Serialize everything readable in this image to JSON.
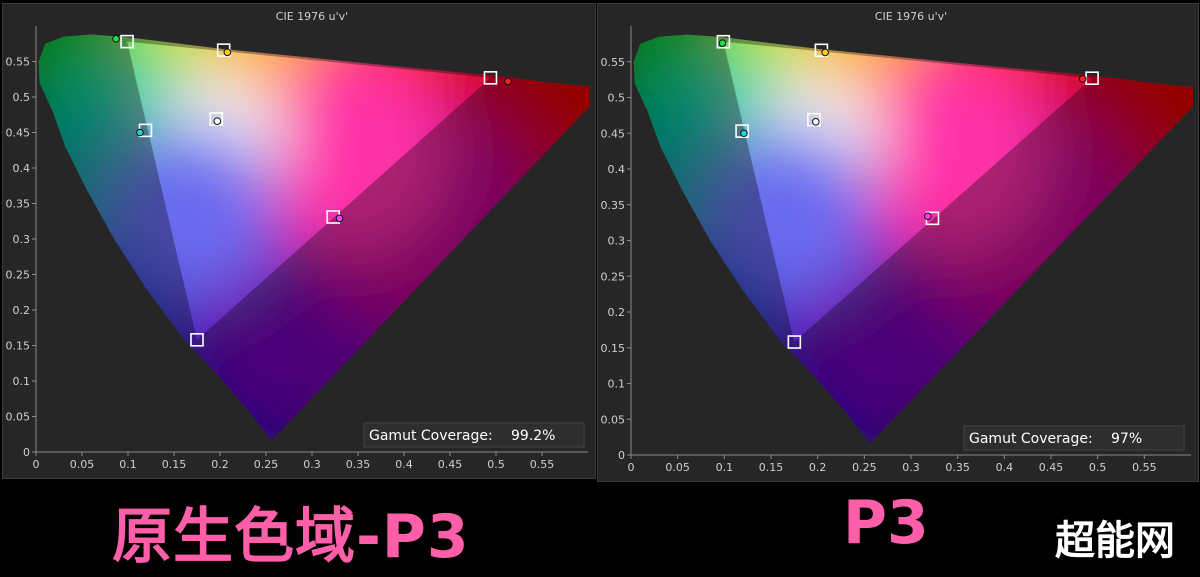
{
  "chart_data": [
    {
      "type": "scatter",
      "title": "CIE 1976 u'v'",
      "xlim": [
        0,
        0.6
      ],
      "ylim": [
        0,
        0.6
      ],
      "xticks": [
        "0",
        "0.05",
        "0.1",
        "0.15",
        "0.2",
        "0.25",
        "0.3",
        "0.35",
        "0.4",
        "0.45",
        "0.5",
        "0.55"
      ],
      "yticks": [
        "0",
        "0.05",
        "0.1",
        "0.15",
        "0.2",
        "0.25",
        "0.3",
        "0.35",
        "0.4",
        "0.45",
        "0.5",
        "0.55"
      ],
      "grid": false,
      "series": [
        {
          "marker": "square",
          "points": [
            {
              "x": 0.099,
              "y": 0.578
            },
            {
              "x": 0.204,
              "y": 0.566
            },
            {
              "x": 0.494,
              "y": 0.527
            },
            {
              "x": 0.196,
              "y": 0.469
            },
            {
              "x": 0.119,
              "y": 0.453
            },
            {
              "x": 0.323,
              "y": 0.331
            },
            {
              "x": 0.175,
              "y": 0.158
            }
          ]
        },
        {
          "marker": "circle",
          "points": [
            {
              "x": 0.087,
              "y": 0.582,
              "color": "#22dd44"
            },
            {
              "x": 0.208,
              "y": 0.563,
              "color": "#ffd000"
            },
            {
              "x": 0.513,
              "y": 0.522,
              "color": "#ff2020"
            },
            {
              "x": 0.197,
              "y": 0.466,
              "color": "#ffffff"
            },
            {
              "x": 0.113,
              "y": 0.45,
              "color": "#20d0e0"
            },
            {
              "x": 0.33,
              "y": 0.329,
              "color": "#ff40ff"
            }
          ]
        }
      ],
      "annotation_label": "Gamut Coverage:",
      "annotation_value": "99.2%"
    },
    {
      "type": "scatter",
      "title": "CIE 1976 u'v'",
      "xlim": [
        0,
        0.6
      ],
      "ylim": [
        0,
        0.6
      ],
      "xticks": [
        "0",
        "0.05",
        "0.1",
        "0.15",
        "0.2",
        "0.25",
        "0.3",
        "0.35",
        "0.4",
        "0.45",
        "0.5",
        "0.55"
      ],
      "yticks": [
        "0",
        "0.05",
        "0.1",
        "0.15",
        "0.2",
        "0.25",
        "0.3",
        "0.35",
        "0.4",
        "0.45",
        "0.5",
        "0.55"
      ],
      "grid": false,
      "series": [
        {
          "marker": "square",
          "points": [
            {
              "x": 0.099,
              "y": 0.578
            },
            {
              "x": 0.204,
              "y": 0.566
            },
            {
              "x": 0.494,
              "y": 0.527
            },
            {
              "x": 0.196,
              "y": 0.469
            },
            {
              "x": 0.119,
              "y": 0.453
            },
            {
              "x": 0.323,
              "y": 0.331
            },
            {
              "x": 0.175,
              "y": 0.158
            }
          ]
        },
        {
          "marker": "circle",
          "points": [
            {
              "x": 0.098,
              "y": 0.576,
              "color": "#22dd44"
            },
            {
              "x": 0.208,
              "y": 0.563,
              "color": "#ffd000"
            },
            {
              "x": 0.484,
              "y": 0.526,
              "color": "#ff2020"
            },
            {
              "x": 0.198,
              "y": 0.466,
              "color": "#ffffff"
            },
            {
              "x": 0.121,
              "y": 0.45,
              "color": "#20d0e0"
            },
            {
              "x": 0.318,
              "y": 0.334,
              "color": "#ff40ff"
            }
          ]
        }
      ],
      "annotation_label": "Gamut Coverage:",
      "annotation_value": "97%"
    }
  ],
  "captions": {
    "left": "原生色域-P3",
    "right": "P3"
  },
  "brand": "超能网",
  "colors": {
    "caption": "#ff5fa8",
    "panel_bg": "#262626",
    "page_bg": "#000000"
  }
}
